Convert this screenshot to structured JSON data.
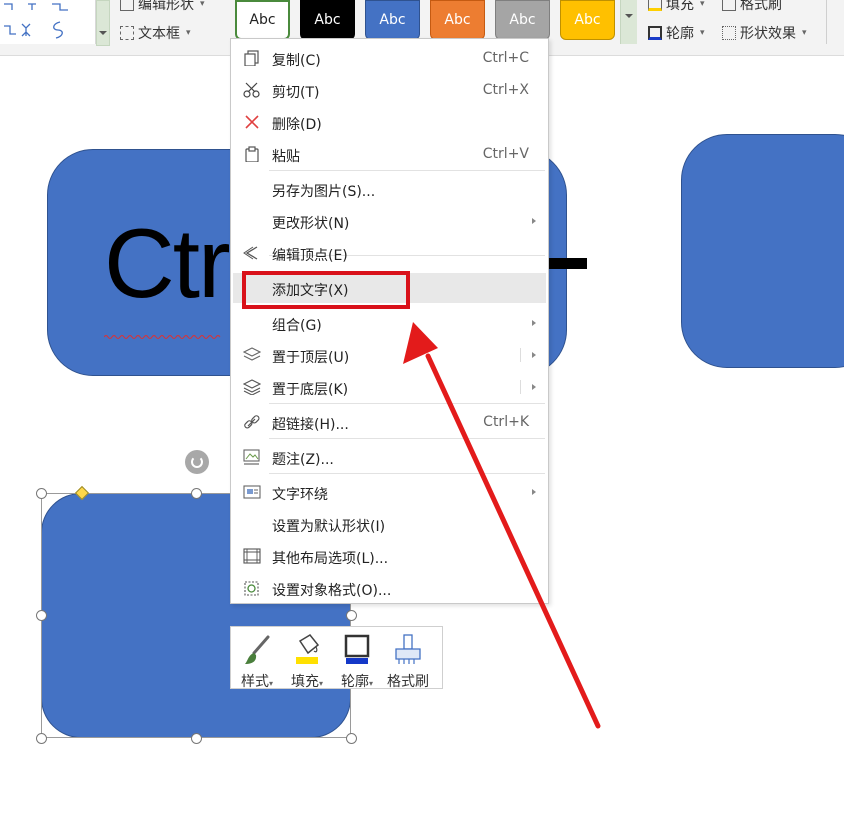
{
  "ribbon": {
    "edit_shape_label": "编辑形状",
    "textbox_label": "文本框",
    "styles": [
      {
        "label": "Abc",
        "bg": "#ffffff",
        "fg": "#222222",
        "border": "#4a8a3c"
      },
      {
        "label": "Abc",
        "bg": "#000000",
        "fg": "#ffffff",
        "border": "#000000"
      },
      {
        "label": "Abc",
        "bg": "#4472c4",
        "fg": "#ffffff",
        "border": "#2f528f"
      },
      {
        "label": "Abc",
        "bg": "#ed7d31",
        "fg": "#ffffff",
        "border": "#c55a11"
      },
      {
        "label": "Abc",
        "bg": "#a5a5a5",
        "fg": "#ffffff",
        "border": "#7f7f7f"
      },
      {
        "label": "Abc",
        "bg": "#ffc000",
        "fg": "#ffffff",
        "border": "#bf9000"
      }
    ],
    "fill_label": "填充",
    "format_painter_label": "格式刷",
    "outline_label": "轮廓",
    "shape_effects_label": "形状效果"
  },
  "canvas": {
    "big_text": "Ctr",
    "shape_color": "#4472c4"
  },
  "context_menu": {
    "items": [
      {
        "label": "复制(C)",
        "shortcut": "Ctrl+C",
        "icon": "copy-icon"
      },
      {
        "label": "剪切(T)",
        "shortcut": "Ctrl+X",
        "icon": "cut-icon"
      },
      {
        "label": "删除(D)",
        "shortcut": "",
        "icon": "delete-icon"
      },
      {
        "label": "粘贴",
        "shortcut": "Ctrl+V",
        "icon": "paste-icon"
      },
      {
        "label": "另存为图片(S)...",
        "shortcut": "",
        "icon": ""
      },
      {
        "label": "更改形状(N)",
        "shortcut": "",
        "icon": "",
        "submenu": true
      },
      {
        "label": "编辑顶点(E)",
        "shortcut": "",
        "icon": "edit-points-icon"
      },
      {
        "label": "添加文字(X)",
        "shortcut": "",
        "icon": "",
        "highlighted": true
      },
      {
        "label": "组合(G)",
        "shortcut": "",
        "icon": "",
        "submenu": true
      },
      {
        "label": "置于顶层(U)",
        "shortcut": "",
        "icon": "bring-to-front-icon",
        "submenu": true
      },
      {
        "label": "置于底层(K)",
        "shortcut": "",
        "icon": "send-to-back-icon",
        "submenu": true
      },
      {
        "label": "超链接(H)...",
        "shortcut": "Ctrl+K",
        "icon": "hyperlink-icon"
      },
      {
        "label": "题注(Z)...",
        "shortcut": "",
        "icon": "caption-icon"
      },
      {
        "label": "文字环绕",
        "shortcut": "",
        "icon": "text-wrap-icon",
        "submenu": true
      },
      {
        "label": "设置为默认形状(I)",
        "shortcut": "",
        "icon": ""
      },
      {
        "label": "其他布局选项(L)...",
        "shortcut": "",
        "icon": "layout-options-icon"
      },
      {
        "label": "设置对象格式(O)...",
        "shortcut": "",
        "icon": "format-object-icon"
      }
    ]
  },
  "mini_toolbar": {
    "style_label": "样式",
    "fill_label": "填充",
    "outline_label": "轮廓",
    "painter_label": "格式刷"
  },
  "annotation": {
    "highlight_color": "#d9111a"
  }
}
